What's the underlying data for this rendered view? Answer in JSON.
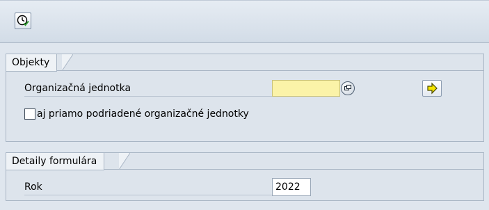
{
  "toolbar": {
    "execute_icon": "clock-execute-icon"
  },
  "objects_group": {
    "title": "Objekty",
    "org_unit_label": "Organizačná jednotka",
    "org_unit_value": "",
    "value_help_icon": "value-help-icon",
    "action_icon": "arrow-right-icon",
    "checkbox_label": "aj priamo podriadené organizačné jednotky",
    "checkbox_checked": false
  },
  "details_group": {
    "title": "Detaily formulára",
    "year_label": "Rok",
    "year_value": "2022"
  },
  "colors": {
    "background": "#dfe6ee",
    "required_field": "#fbf3a8",
    "border": "#a9b6c5"
  }
}
